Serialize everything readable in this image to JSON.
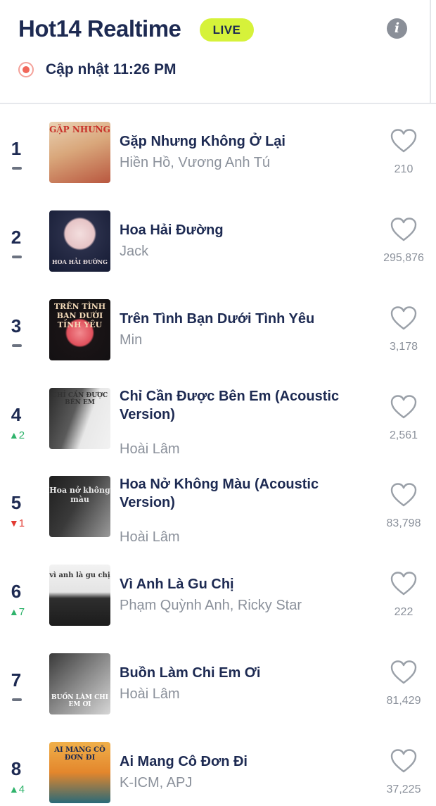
{
  "header": {
    "title": "Hot14 Realtime",
    "live_label": "LIVE",
    "info_icon": "info-icon",
    "update_text": "Cập nhật 11:26 PM"
  },
  "colors": {
    "primary_text": "#1d2a52",
    "live_badge": "#d6f23a",
    "rank_up": "#2fb36b",
    "rank_down": "#e23a32",
    "muted": "#8b919b",
    "update_dot": "#f1675a"
  },
  "songs": [
    {
      "rank": "1",
      "movement": "same",
      "change": "",
      "title": "Gặp Nhưng Không Ở Lại",
      "artist": "Hiền Hồ, Vương Anh Tú",
      "likes": "210",
      "cover_text": "GẶP NHƯNG"
    },
    {
      "rank": "2",
      "movement": "same",
      "change": "",
      "title": "Hoa Hải Đường",
      "artist": "Jack",
      "likes": "295,876",
      "cover_text": "HOA HẢI ĐƯỜNG"
    },
    {
      "rank": "3",
      "movement": "same",
      "change": "",
      "title": "Trên Tình Bạn Dưới Tình Yêu",
      "artist": "Min",
      "likes": "3,178",
      "cover_text": "TRÊN TÌNH BẠN DƯỚI TÌNH YÊU"
    },
    {
      "rank": "4",
      "movement": "up",
      "change": "2",
      "title": "Chỉ Cần Được Bên Em (Acoustic Version)",
      "artist": "Hoài Lâm",
      "likes": "2,561",
      "cover_text": "CHỈ CẦN ĐƯỢC BÊN EM"
    },
    {
      "rank": "5",
      "movement": "down",
      "change": "1",
      "title": "Hoa Nở Không Màu (Acoustic Version)",
      "artist": "Hoài Lâm",
      "likes": "83,798",
      "cover_text": "Hoa nở không màu"
    },
    {
      "rank": "6",
      "movement": "up",
      "change": "7",
      "title": "Vì Anh Là Gu Chị",
      "artist": "Phạm Quỳnh Anh, Ricky Star",
      "likes": "222",
      "cover_text": "vì anh là gu chị"
    },
    {
      "rank": "7",
      "movement": "same",
      "change": "",
      "title": "Buồn Làm Chi Em Ơi",
      "artist": "Hoài Lâm",
      "likes": "81,429",
      "cover_text": "BUỒN LÀM CHI EM ƠI"
    },
    {
      "rank": "8",
      "movement": "up",
      "change": "4",
      "title": "Ai Mang Cô Đơn Đi",
      "artist": "K-ICM, APJ",
      "likes": "37,225",
      "cover_text": "AI MANG CÔ ĐƠN ĐI"
    }
  ]
}
